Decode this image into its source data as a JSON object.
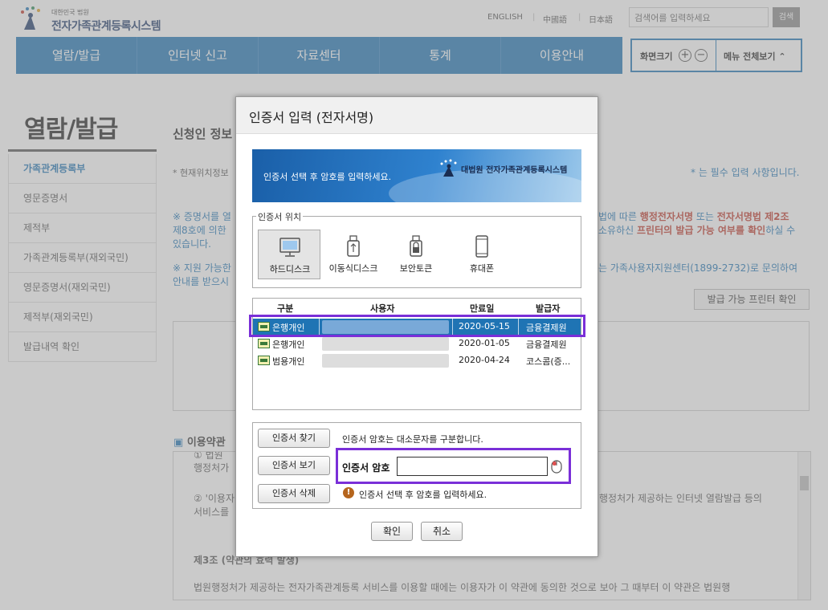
{
  "header": {
    "org_small": "대한민국 법원",
    "site_title": "전자가족관계등록시스템",
    "languages": [
      "ENGLISH",
      "中國語",
      "日本語"
    ],
    "search_placeholder": "검색어를 입력하세요",
    "search_button": "검색"
  },
  "gnb": {
    "items": [
      "열람/발급",
      "인터넷 신고",
      "자료센터",
      "통계",
      "이용안내"
    ],
    "zoom_label": "화면크기",
    "menu_all": "메뉴 전체보기"
  },
  "lnb": {
    "title": "열람/발급",
    "items": [
      "가족관계등록부",
      "영문증명서",
      "제적부",
      "가족관계등록부(재외국민)",
      "영문증명서(재외국민)",
      "제적부(재외국민)",
      "발급내역 확인"
    ]
  },
  "content": {
    "title": "신청인 정보",
    "location_note": "* 현재위치정보",
    "required_note": "* 는 필수 입력 사항입니다.",
    "notice1_left": "※ 증명서를 열",
    "notice1_right_a": "법에 따른 ",
    "notice1_right_b": "행정전자서명",
    "notice1_right_c": " 또는 ",
    "notice1_right_d": "전자서명법 제2조",
    "notice2_left": "제8호에 의한 ",
    "notice2_right_a": "소유하신 ",
    "notice2_right_b": "프린터의 발급 가능 여부를 확인",
    "notice2_right_c": "하실 수",
    "notice3_left": "있습니다.",
    "notice4_left": "※ 지원 가능한",
    "notice4_right": "는 가족사용자지원센터(1899-2732)로 문의하여",
    "notice5_left": "안내를 받으시",
    "printer_button": "발급 가능 프린터 확인",
    "terms_title": "이용약관",
    "terms_line1_left": "행정처가",
    "terms_line1_top": "① 법원",
    "terms_line2_left": "② '이용자",
    "terms_line2_right": "행정처가 제공하는 인터넷 열람발급 등의",
    "terms_line3_left": "서비스를",
    "terms_article": "제3조 (약관의 효력 발생)",
    "terms_body": "법원행정처가 제공하는 전자가족관계등록 서비스를 이용할 때에는 이용자가 이 약관에 동의한 것으로 보아 그 때부터 이 약관은 법원행"
  },
  "dialog": {
    "title": "인증서 입력 (전자서명)",
    "banner_text": "인증서 선택 후 암호를 입력하세요.",
    "banner_logo": "대법원 전자가족관계등록시스템",
    "location_legend": "인증서 위치",
    "locations": [
      {
        "label": "하드디스크",
        "icon": "monitor-icon",
        "selected": true
      },
      {
        "label": "이동식디스크",
        "icon": "usb-icon",
        "selected": false
      },
      {
        "label": "보안토큰",
        "icon": "lock-token-icon",
        "selected": false
      },
      {
        "label": "휴대폰",
        "icon": "phone-icon",
        "selected": false
      }
    ],
    "table_headers": [
      "구분",
      "사용자",
      "만료일",
      "발급자"
    ],
    "certificates": [
      {
        "type": "은행개인",
        "expiry": "2020-05-15",
        "issuer": "금융결제원",
        "selected": true
      },
      {
        "type": "은행개인",
        "expiry": "2020-01-05",
        "issuer": "금융결제원",
        "selected": false
      },
      {
        "type": "범용개인",
        "expiry": "2020-04-24",
        "issuer": "코스콤(증...",
        "selected": false
      }
    ],
    "buttons": {
      "find": "인증서 찾기",
      "view": "인증서 보기",
      "delete": "인증서 삭제",
      "ok": "확인",
      "cancel": "취소"
    },
    "case_note": "인증서 암호는 대소문자를 구분합니다.",
    "password_label": "인증서 암호",
    "password_value": "",
    "warning_text": "인증서 선택 후 암호를 입력하세요."
  },
  "colors": {
    "nav_blue": "#1f74b4",
    "highlight_purple": "#7a2fd8",
    "selected_row": "#1f74b4"
  }
}
